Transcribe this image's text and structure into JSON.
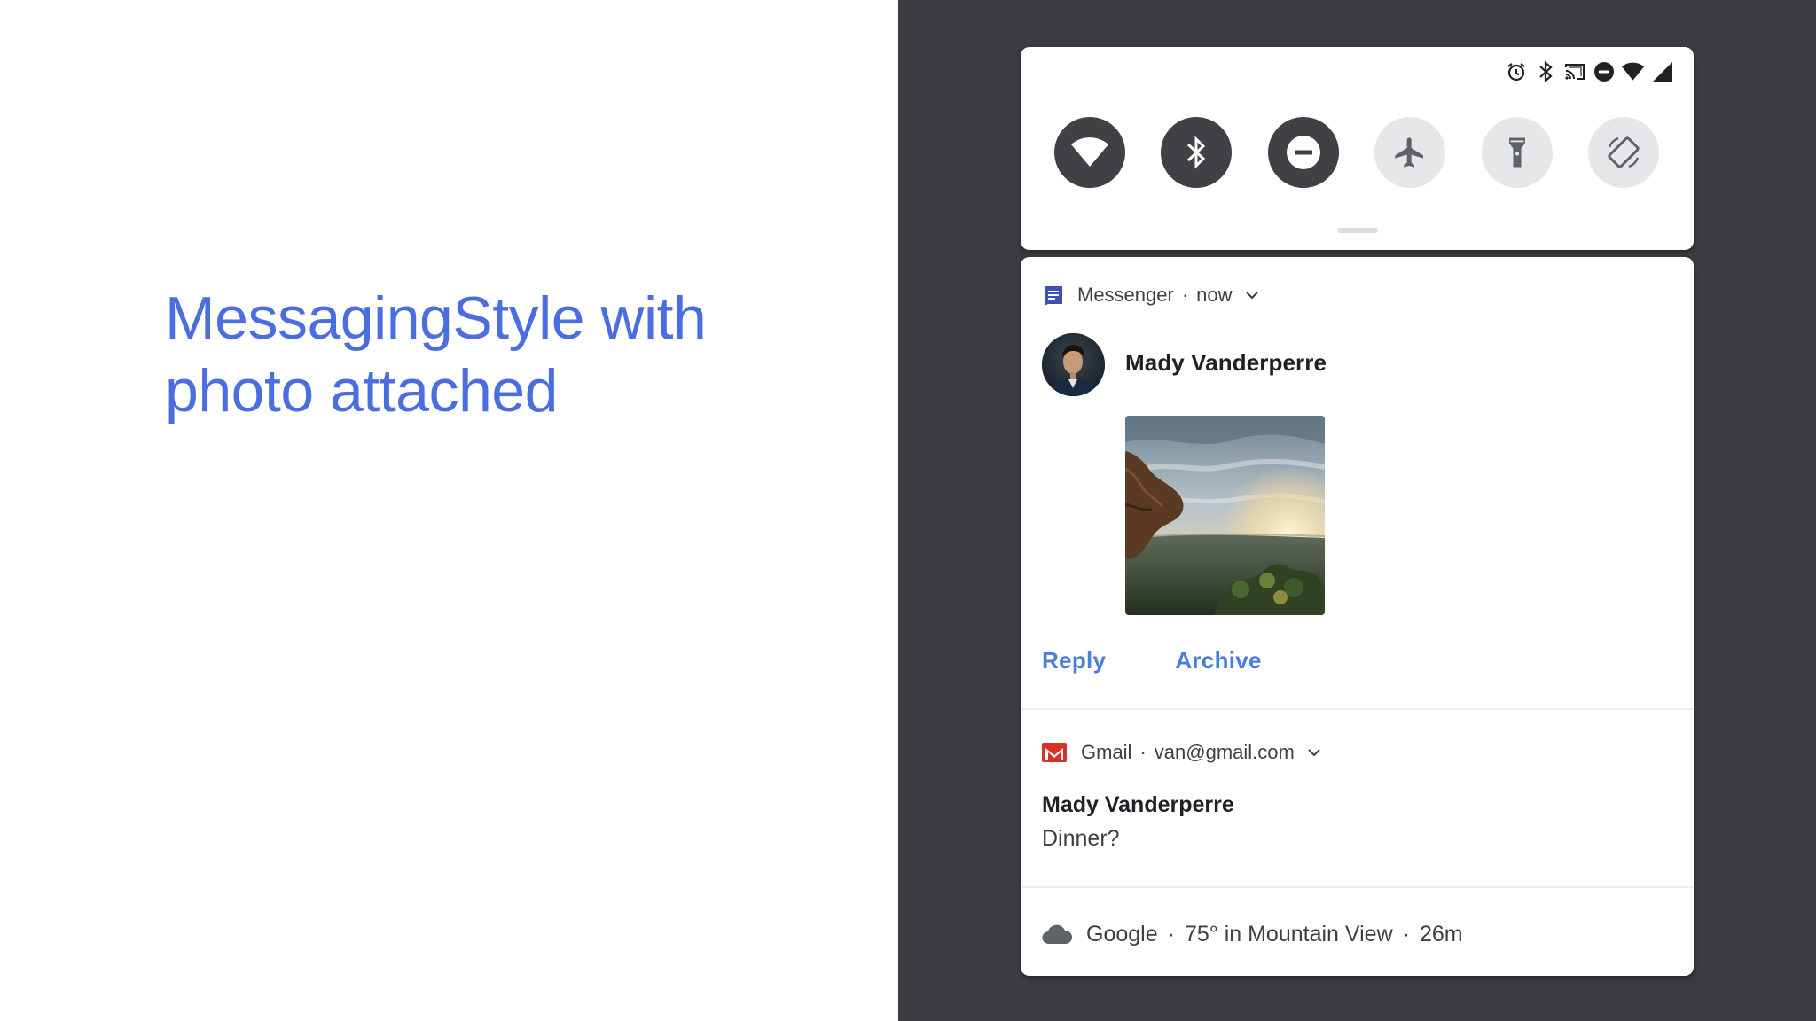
{
  "slide": {
    "title_line1": "MessagingStyle with",
    "title_line2": "photo attached"
  },
  "status_bar": {
    "icons": [
      "alarm-icon",
      "bluetooth-icon",
      "cast-icon",
      "do-not-disturb-icon",
      "wifi-icon",
      "cellular-signal-icon"
    ]
  },
  "quick_settings": {
    "tiles": [
      {
        "name": "wifi",
        "icon": "wifi-icon",
        "state": "on"
      },
      {
        "name": "bluetooth",
        "icon": "bluetooth-icon",
        "state": "on"
      },
      {
        "name": "do-not-disturb",
        "icon": "do-not-disturb-icon",
        "state": "on"
      },
      {
        "name": "airplane-mode",
        "icon": "airplane-icon",
        "state": "off"
      },
      {
        "name": "flashlight",
        "icon": "flashlight-icon",
        "state": "off"
      },
      {
        "name": "auto-rotate",
        "icon": "auto-rotate-icon",
        "state": "off"
      }
    ]
  },
  "messenger_notification": {
    "app_name": "Messenger",
    "separator": "·",
    "time": "now",
    "sender": "Mady Vanderperre",
    "attachment": "photo",
    "actions": {
      "reply": "Reply",
      "archive": "Archive"
    }
  },
  "gmail_notification": {
    "app_name": "Gmail",
    "separator": "·",
    "account": "van@gmail.com",
    "sender": "Mady Vanderperre",
    "message": "Dinner?"
  },
  "weather_notification": {
    "app_name": "Google",
    "separator": "·",
    "summary": "75° in Mountain View",
    "time": "26m"
  },
  "colors": {
    "title_blue": "#4a6ee0",
    "action_blue": "#4a7fd8",
    "dark_bg": "#3b3c3f",
    "tile_on": "#3f4144",
    "tile_off": "#e6e7e8",
    "messenger_icon": "#3f51b5",
    "gmail_red": "#d93025"
  }
}
